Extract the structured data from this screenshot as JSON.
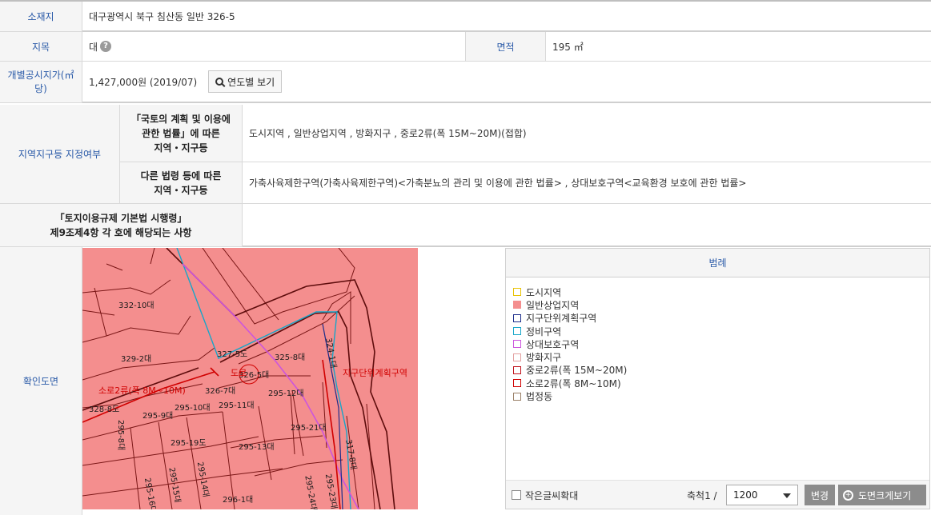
{
  "location": {
    "label": "소재지",
    "value": "대구광역시 북구 침산동 일반 326-5"
  },
  "land_category": {
    "label": "지목",
    "value": "대",
    "help_icon": "?"
  },
  "area": {
    "label": "면적",
    "value": "195 ㎡"
  },
  "official_price": {
    "label_line1": "개별공시지가(㎡",
    "label_line2": "당)",
    "value": "1,427,000원 (2019/07)",
    "button_label": "연도별 보기"
  },
  "zone": {
    "label": "지역지구등 지정여부",
    "national_law": {
      "label_line1": "「국토의 계획 및 이용에",
      "label_line2": "관한 법률」에 따른",
      "label_line3": "지역・지구등",
      "value": "도시지역 , 일반상업지역 , 방화지구 , 중로2류(폭 15M~20M)(접합)"
    },
    "other_law": {
      "label_line1": "다른 법령 등에 따른",
      "label_line2": "지역・지구등",
      "value": "가축사육제한구역(가축사육제한구역)<가축분뇨의 관리 및 이용에 관한 법률> , 상대보호구역<교육환경 보호에 관한 법률>"
    }
  },
  "enforcement": {
    "label_line1": "「토지이용규제 기본법 시행령」",
    "label_line2": "제9조제4항 각 호에 해당되는 사항",
    "value": ""
  },
  "map_section": {
    "label": "확인도면",
    "parcels": [
      "332-10대",
      "329-2대",
      "327-5도",
      "325-8대",
      "326-5대",
      "326-7대",
      "328-8도",
      "295-9대",
      "295-10대",
      "295-11대",
      "295-12대",
      "295-8대",
      "295-19도",
      "295-13대",
      "295-21대",
      "295-15대",
      "295-14대",
      "295-16대",
      "296-1대",
      "295-24대",
      "295-23대",
      "317-8대"
    ],
    "overlay_labels": {
      "road_small": "소로2류(폭 8M~10M)",
      "road_mid": "도로",
      "district": "지구단위계획구역"
    }
  },
  "legend": {
    "title": "범례",
    "items": [
      {
        "label": "도시지역",
        "color": "#e8c200",
        "fill": "#ffffff"
      },
      {
        "label": "일반상업지역",
        "color": "#f48e8e",
        "fill": "#f48e8e"
      },
      {
        "label": "지구단위계획구역",
        "color": "#1b2c8a",
        "fill": "#ffffff"
      },
      {
        "label": "정비구역",
        "color": "#17a6c9",
        "fill": "#ffffff"
      },
      {
        "label": "상대보호구역",
        "color": "#cc55dd",
        "fill": "#ffffff"
      },
      {
        "label": "방화지구",
        "color": "#e39f9f",
        "fill": "#ffffff"
      },
      {
        "label": "중로2류(폭 15M~20M)",
        "color": "#c0111a",
        "fill": "#ffffff"
      },
      {
        "label": "소로2류(폭 8M~10M)",
        "color": "#d00000",
        "fill": "#ffffff"
      },
      {
        "label": "법정동",
        "color": "#9a7f66",
        "fill": "#ffffff"
      }
    ],
    "large_text_label": "작은글씨확대",
    "scale_label": "축척1 /",
    "scale_value": "1200",
    "change_button": "변경",
    "big_map_button": "도면크게보기"
  }
}
